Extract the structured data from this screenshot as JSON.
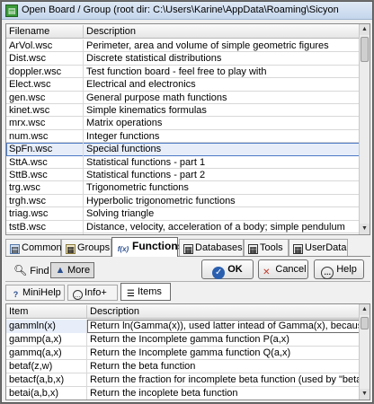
{
  "window": {
    "title": "Open Board / Group   (root dir: C:\\Users\\Karine\\AppData\\Roaming\\Sicyon"
  },
  "boards": {
    "columns": [
      "Filename",
      "Description"
    ],
    "selected_index": 9,
    "rows": [
      {
        "file": "ArVol.wsc",
        "desc": "Perimeter, area and volume of simple geometric figures"
      },
      {
        "file": "Dist.wsc",
        "desc": "Discrete statistical distributions"
      },
      {
        "file": "doppler.wsc",
        "desc": "Test function board - feel free to play with"
      },
      {
        "file": "Elect.wsc",
        "desc": "Electrical and electronics"
      },
      {
        "file": "gen.wsc",
        "desc": "General purpose math functions"
      },
      {
        "file": "kinet.wsc",
        "desc": "Simple kinematics formulas"
      },
      {
        "file": "mrx.wsc",
        "desc": "Matrix operations"
      },
      {
        "file": "num.wsc",
        "desc": "Integer functions"
      },
      {
        "file": "SpFn.wsc",
        "desc": "Special functions"
      },
      {
        "file": "SttA.wsc",
        "desc": "Statistical functions - part 1"
      },
      {
        "file": "SttB.wsc",
        "desc": "Statistical functions - part 2"
      },
      {
        "file": "trg.wsc",
        "desc": "Trigonometric functions"
      },
      {
        "file": "trgh.wsc",
        "desc": "Hyperbolic trigonometric functions"
      },
      {
        "file": "triag.wsc",
        "desc": "Solving triangle"
      },
      {
        "file": "tstB.wsc",
        "desc": "Distance, velocity, acceleration of a body; simple pendulum"
      }
    ]
  },
  "tabs": [
    {
      "label": "Common",
      "icon": "common-icon"
    },
    {
      "label": "Groups",
      "icon": "groups-icon"
    },
    {
      "label": "Functions",
      "icon": "functions-icon",
      "icon_text": "f(x)"
    },
    {
      "label": "Databases",
      "icon": "databases-icon"
    },
    {
      "label": "Tools",
      "icon": "tools-icon"
    },
    {
      "label": "UserData",
      "icon": "userdata-icon"
    }
  ],
  "toolbar": {
    "find_label": "Find",
    "more_label": "More",
    "ok_label": "OK",
    "cancel_label": "Cancel",
    "help_label": "Help"
  },
  "subtabs": [
    {
      "label": "MiniHelp"
    },
    {
      "label": "Info+"
    },
    {
      "label": "Items"
    }
  ],
  "items": {
    "columns": [
      "Item",
      "Description"
    ],
    "rows": [
      {
        "item": "gammln(x)",
        "desc": "Return ln(Gamma(x)), used latter intead of Gamma(x), because of"
      },
      {
        "item": "gammp(a,x)",
        "desc": "Return the Incomplete gamma function P(a,x)"
      },
      {
        "item": "gammq(a,x)",
        "desc": "Return the Incomplete gamma function Q(a,x)"
      },
      {
        "item": "betaf(z,w)",
        "desc": "Return the beta function"
      },
      {
        "item": "betacf(a,b,x)",
        "desc": "Return the fraction for incomplete beta function (used by \"betai\")"
      },
      {
        "item": "betai(a,b,x)",
        "desc": "Return the incoplete beta function"
      }
    ]
  },
  "colors": {
    "selection_border": "#4c78c4",
    "ok_accent": "#2a5fb0",
    "cancel_accent": "#c0392b"
  }
}
